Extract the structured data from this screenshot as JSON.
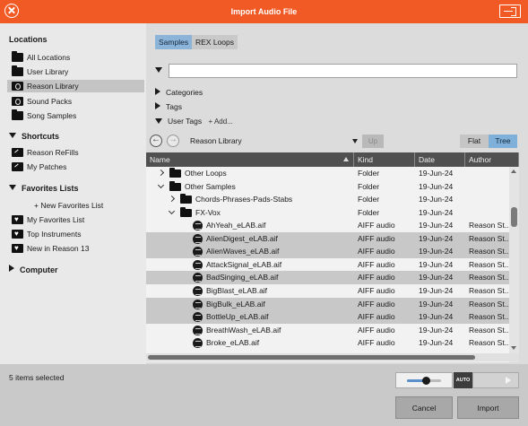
{
  "window": {
    "title": "Import Audio File"
  },
  "sidebar": {
    "locations_title": "Locations",
    "locations": [
      {
        "label": "All Locations",
        "icon": "folder-icon"
      },
      {
        "label": "User Library",
        "icon": "folder-icon"
      },
      {
        "label": "Reason Library",
        "icon": "reason-library-icon",
        "selected": true
      },
      {
        "label": "Sound Packs",
        "icon": "sound-pack-icon"
      },
      {
        "label": "Song Samples",
        "icon": "folder-icon"
      }
    ],
    "shortcuts_title": "Shortcuts",
    "shortcuts": [
      {
        "label": "Reason ReFills",
        "icon": "shortcut-icon"
      },
      {
        "label": "My Patches",
        "icon": "shortcut-icon"
      }
    ],
    "favorites_title": "Favorites Lists",
    "new_favorites": "+ New Favorites List",
    "favorites": [
      {
        "label": "My Favorites List",
        "icon": "favorites-icon"
      },
      {
        "label": "Top Instruments",
        "icon": "favorites-icon"
      },
      {
        "label": "New in Reason 13",
        "icon": "favorites-icon"
      }
    ],
    "computer_title": "Computer"
  },
  "tabs": [
    {
      "label": "Samples",
      "active": true
    },
    {
      "label": "REX Loops",
      "active": false
    }
  ],
  "search": {
    "value": "",
    "placeholder": ""
  },
  "filters": {
    "categories": "Categories",
    "tags": "Tags",
    "user_tags": "User Tags",
    "add_label": "+ Add..."
  },
  "nav": {
    "path": "Reason Library",
    "up": "Up",
    "flat": "Flat",
    "tree": "Tree"
  },
  "table": {
    "columns": [
      "Name",
      "Kind",
      "Date",
      "Author"
    ],
    "rows": [
      {
        "name": "Other Loops",
        "kind": "Folder",
        "date": "19-Jun-24",
        "author": "",
        "type": "folder",
        "indent": 0,
        "expander": "closed",
        "selected": false
      },
      {
        "name": "Other Samples",
        "kind": "Folder",
        "date": "19-Jun-24",
        "author": "",
        "type": "folder",
        "indent": 0,
        "expander": "open",
        "selected": false
      },
      {
        "name": "Chords-Phrases-Pads-Stabs",
        "kind": "Folder",
        "date": "19-Jun-24",
        "author": "",
        "type": "folder",
        "indent": 1,
        "expander": "closed",
        "selected": false
      },
      {
        "name": "FX-Vox",
        "kind": "Folder",
        "date": "19-Jun-24",
        "author": "",
        "type": "folder",
        "indent": 1,
        "expander": "open",
        "selected": false
      },
      {
        "name": "AhYeah_eLAB.aif",
        "kind": "AIFF audio",
        "date": "19-Jun-24",
        "author": "Reason St...",
        "type": "audio",
        "indent": 2,
        "expander": "",
        "selected": false
      },
      {
        "name": "AlienDigest_eLAB.aif",
        "kind": "AIFF audio",
        "date": "19-Jun-24",
        "author": "Reason St...",
        "type": "audio",
        "indent": 2,
        "expander": "",
        "selected": true
      },
      {
        "name": "AlienWaves_eLAB.aif",
        "kind": "AIFF audio",
        "date": "19-Jun-24",
        "author": "Reason St...",
        "type": "audio",
        "indent": 2,
        "expander": "",
        "selected": true
      },
      {
        "name": "AttackSignal_eLAB.aif",
        "kind": "AIFF audio",
        "date": "19-Jun-24",
        "author": "Reason St...",
        "type": "audio",
        "indent": 2,
        "expander": "",
        "selected": false
      },
      {
        "name": "BadSinging_eLAB.aif",
        "kind": "AIFF audio",
        "date": "19-Jun-24",
        "author": "Reason St...",
        "type": "audio",
        "indent": 2,
        "expander": "",
        "selected": true
      },
      {
        "name": "BigBlast_eLAB.aif",
        "kind": "AIFF audio",
        "date": "19-Jun-24",
        "author": "Reason St...",
        "type": "audio",
        "indent": 2,
        "expander": "",
        "selected": false
      },
      {
        "name": "BigBulk_eLAB.aif",
        "kind": "AIFF audio",
        "date": "19-Jun-24",
        "author": "Reason St...",
        "type": "audio",
        "indent": 2,
        "expander": "",
        "selected": true
      },
      {
        "name": "BottleUp_eLAB.aif",
        "kind": "AIFF audio",
        "date": "19-Jun-24",
        "author": "Reason St...",
        "type": "audio",
        "indent": 2,
        "expander": "",
        "selected": true
      },
      {
        "name": "BreathWash_eLAB.aif",
        "kind": "AIFF audio",
        "date": "19-Jun-24",
        "author": "Reason St...",
        "type": "audio",
        "indent": 2,
        "expander": "",
        "selected": false
      },
      {
        "name": "Broke_eLAB.aif",
        "kind": "AIFF audio",
        "date": "19-Jun-24",
        "author": "Reason St...",
        "type": "audio",
        "indent": 2,
        "expander": "",
        "selected": false
      }
    ]
  },
  "footer": {
    "status": "5 items selected",
    "volume_level": 0.55,
    "auto_label": "AUTO",
    "cancel": "Cancel",
    "import": "Import"
  },
  "colors": {
    "titlebar": "#f15a24",
    "accent": "#8cb4d8",
    "selection": "#c8c8c8"
  }
}
